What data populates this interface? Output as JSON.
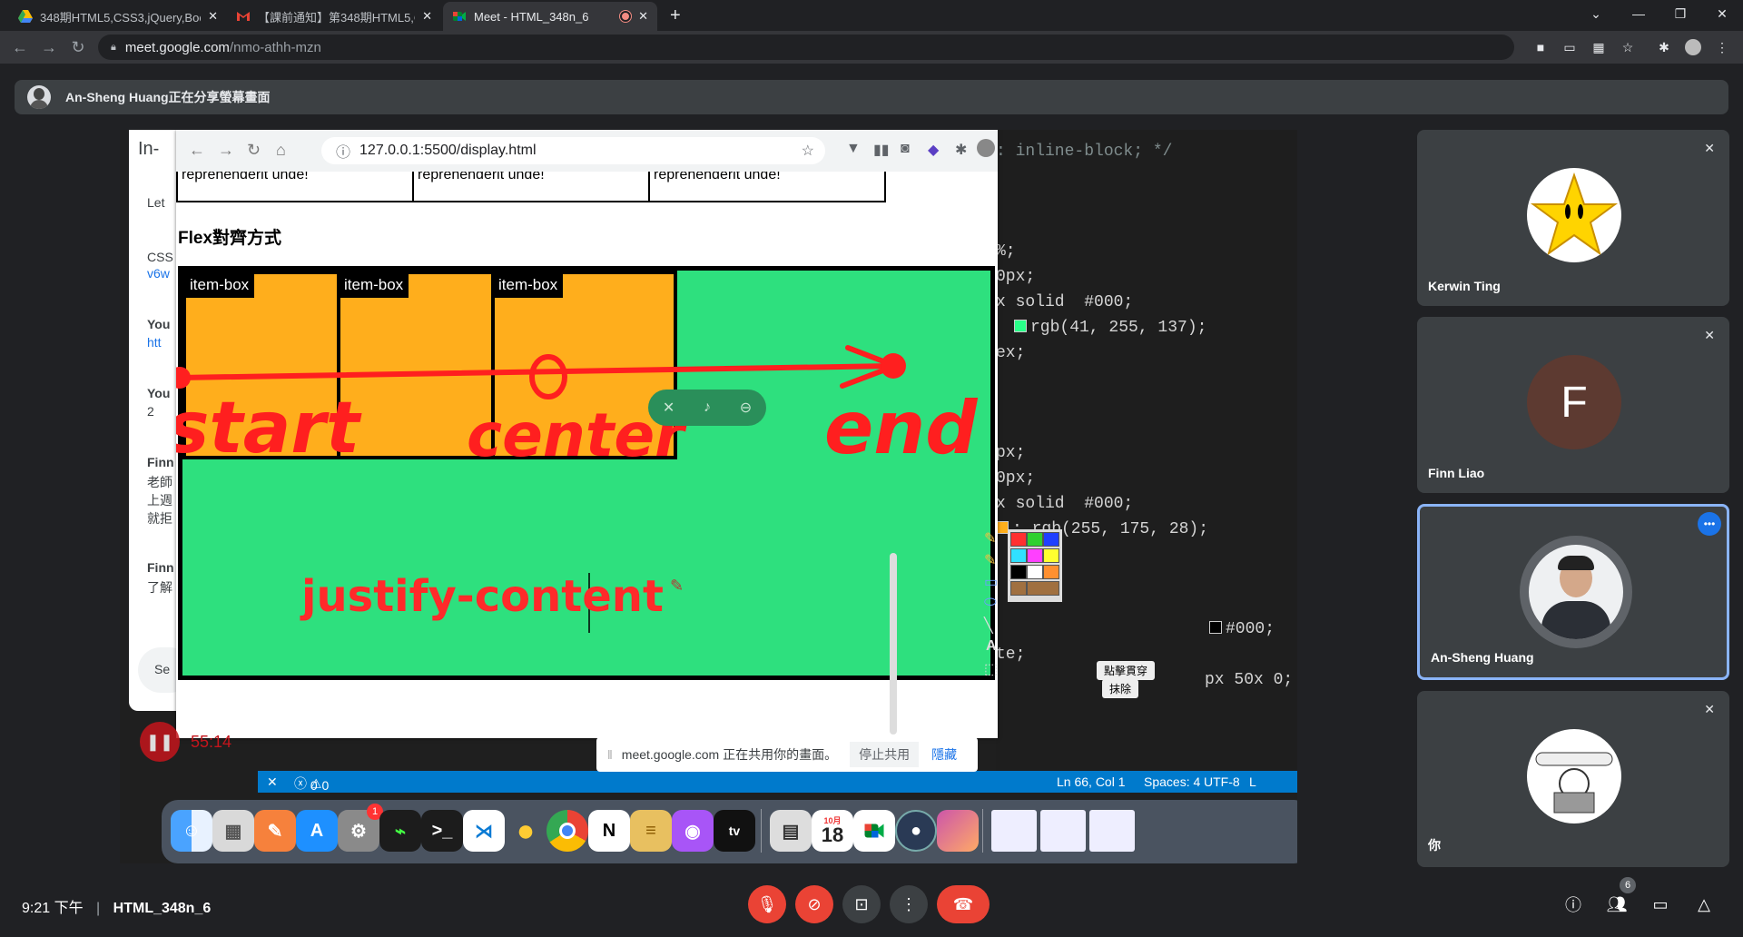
{
  "tabs": [
    {
      "title": "348期HTML5,CSS3,jQuery,Boot",
      "icon": "google-drive-icon"
    },
    {
      "title": "【課前通知】第348期HTML5,CS",
      "icon": "gmail-icon"
    },
    {
      "title": "Meet - HTML_348n_6",
      "icon": "google-meet-icon",
      "recording": true
    }
  ],
  "address": {
    "domain": "meet.google.com",
    "path": "/nmo-athh-mzn"
  },
  "banner": {
    "text": "An-Sheng Huang正在分享螢幕畫面"
  },
  "shared_screen": {
    "chat_panel": {
      "title_partial": "In-",
      "lines": [
        "Let",
        "CSS",
        "v6w",
        "You",
        "htt",
        "You",
        "2",
        "Finn",
        "老師",
        "上週",
        "就拒",
        "Finn",
        "了解",
        "Se"
      ]
    },
    "inner_browser": {
      "url": "127.0.0.1:5500/display.html",
      "table_cells": [
        "reprehenderit unde!",
        "reprehenderit unde!",
        "reprehenderit unde!"
      ],
      "heading": "Flex對齊方式",
      "items": [
        "item-box",
        "item-box",
        "item-box"
      ],
      "annotations": {
        "start": "start",
        "center": "center",
        "end": "end",
        "typed": "justify-content"
      }
    },
    "editor_lines": [
      ": inline-block; */",
      "%;",
      "0px;",
      "x solid  #000;",
      "rgb(41, 255, 137);",
      "ex;",
      "px;",
      "0px;",
      "x solid  #000;",
      ": rgb(255, 175, 28);",
      "#000;",
      "te;",
      "px 50x 0;"
    ],
    "swatch_colors": {
      "black": "#000000",
      "green": "#29ff89",
      "orange": "#ffaf1c"
    },
    "palette_tooltips": {
      "penetrate": "點擊貫穿",
      "erase": "抹除"
    },
    "recording_timer": "55:14",
    "share_bar": {
      "text": "meet.google.com 正在共用你的畫面。",
      "stop": "停止共用",
      "hide": "隱藏"
    },
    "status_bar": {
      "errors": "0",
      "warnings": "0",
      "position": "Ln 66, Col 1",
      "spaces": "Spaces: 4",
      "encoding": "UTF-8",
      "extra": "L"
    },
    "calendar": {
      "month": "10月",
      "day": "18"
    },
    "dock_apps": [
      "finder-icon",
      "launchpad-icon",
      "pages-icon",
      "app-store-icon",
      "system-preferences-icon",
      "activity-monitor-icon",
      "terminal-icon",
      "vscode-icon",
      "cyberduck-icon",
      "chrome-icon",
      "notion-icon",
      "db-icon",
      "podcasts-icon",
      "apple-tv-icon",
      "preview-icon",
      "calendar-icon",
      "facetime-icon",
      "screen-recorder-icon",
      "photos-icon",
      "window1-icon",
      "window2-icon",
      "window3-icon"
    ],
    "system_prefs_badge": "1"
  },
  "participants": [
    {
      "name": "Kerwin Ting",
      "muted": true
    },
    {
      "name": "Finn Liao",
      "initial": "F",
      "muted": true
    },
    {
      "name": "An-Sheng Huang",
      "speaking": true
    },
    {
      "name": "你",
      "muted": true
    }
  ],
  "bottom_bar": {
    "time": "9:21 下午",
    "meeting": "HTML_348n_6",
    "participant_count": "6"
  }
}
